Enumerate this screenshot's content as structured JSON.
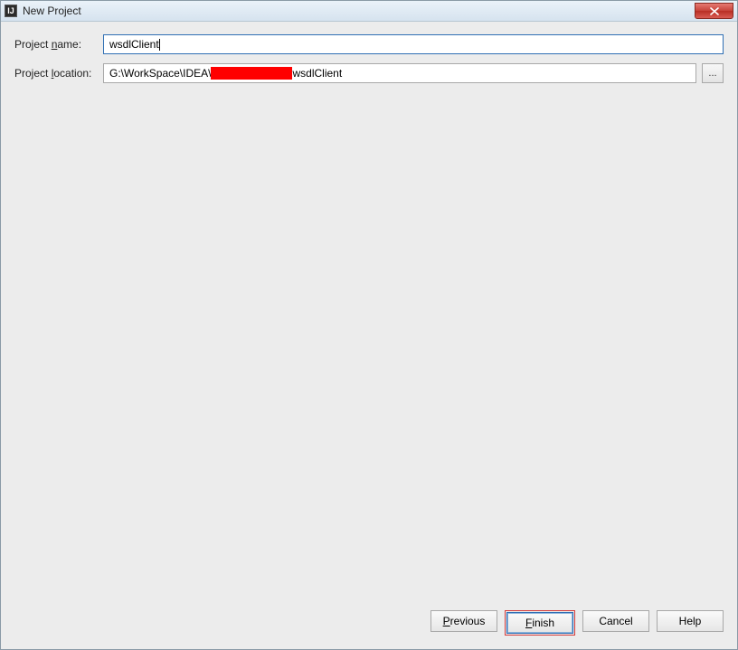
{
  "window": {
    "title": "New Project",
    "app_icon_text": "IJ"
  },
  "form": {
    "project_name_label_pre": "Project ",
    "project_name_label_m": "n",
    "project_name_label_post": "ame:",
    "project_name_value": "wsdlClient",
    "project_location_label_pre": "Project ",
    "project_location_label_m": "l",
    "project_location_label_post": "ocation:",
    "project_location_pre": "G:\\WorkSpace\\IDEA\\",
    "project_location_post": "wsdlClient",
    "browse_label": "..."
  },
  "buttons": {
    "previous_m": "P",
    "previous_rest": "revious",
    "finish_m": "F",
    "finish_rest": "inish",
    "cancel": "Cancel",
    "help": "Help"
  }
}
